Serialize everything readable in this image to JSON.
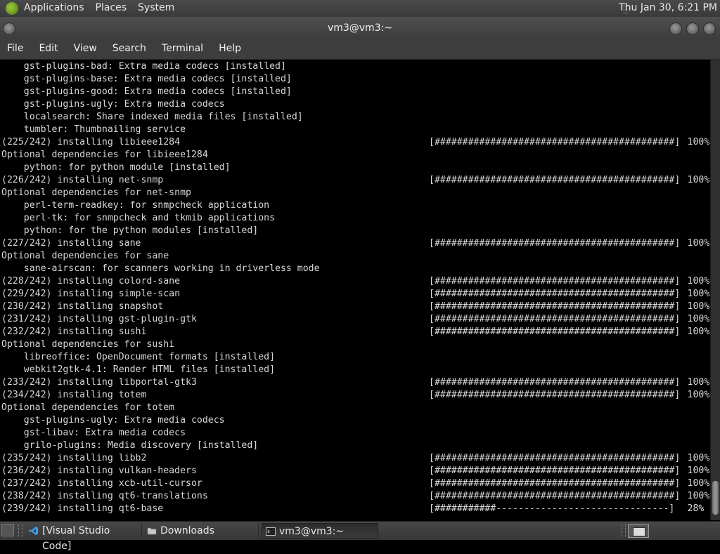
{
  "top_panel": {
    "menus": [
      "Applications",
      "Places",
      "System"
    ],
    "clock": "Thu Jan 30,  6:21 PM"
  },
  "window": {
    "title": "vm3@vm3:~",
    "menu": [
      "File",
      "Edit",
      "View",
      "Search",
      "Terminal",
      "Help"
    ]
  },
  "terminal": {
    "lines": [
      {
        "text": "    gst-plugins-bad: Extra media codecs [installed]",
        "bar": "",
        "pct": ""
      },
      {
        "text": "    gst-plugins-base: Extra media codecs [installed]",
        "bar": "",
        "pct": ""
      },
      {
        "text": "    gst-plugins-good: Extra media codecs [installed]",
        "bar": "",
        "pct": ""
      },
      {
        "text": "    gst-plugins-ugly: Extra media codecs",
        "bar": "",
        "pct": ""
      },
      {
        "text": "    localsearch: Share indexed media files [installed]",
        "bar": "",
        "pct": ""
      },
      {
        "text": "    tumbler: Thumbnailing service",
        "bar": "",
        "pct": ""
      },
      {
        "text": "(225/242) installing libieee1284",
        "bar": "[###########################################]",
        "pct": "100%"
      },
      {
        "text": "Optional dependencies for libieee1284",
        "bar": "",
        "pct": ""
      },
      {
        "text": "    python: for python module [installed]",
        "bar": "",
        "pct": ""
      },
      {
        "text": "(226/242) installing net-snmp",
        "bar": "[###########################################]",
        "pct": "100%"
      },
      {
        "text": "Optional dependencies for net-snmp",
        "bar": "",
        "pct": ""
      },
      {
        "text": "    perl-term-readkey: for snmpcheck application",
        "bar": "",
        "pct": ""
      },
      {
        "text": "    perl-tk: for snmpcheck and tkmib applications",
        "bar": "",
        "pct": ""
      },
      {
        "text": "    python: for the python modules [installed]",
        "bar": "",
        "pct": ""
      },
      {
        "text": "(227/242) installing sane",
        "bar": "[###########################################]",
        "pct": "100%"
      },
      {
        "text": "Optional dependencies for sane",
        "bar": "",
        "pct": ""
      },
      {
        "text": "    sane-airscan: for scanners working in driverless mode",
        "bar": "",
        "pct": ""
      },
      {
        "text": "(228/242) installing colord-sane",
        "bar": "[###########################################]",
        "pct": "100%"
      },
      {
        "text": "(229/242) installing simple-scan",
        "bar": "[###########################################]",
        "pct": "100%"
      },
      {
        "text": "(230/242) installing snapshot",
        "bar": "[###########################################]",
        "pct": "100%"
      },
      {
        "text": "(231/242) installing gst-plugin-gtk",
        "bar": "[###########################################]",
        "pct": "100%"
      },
      {
        "text": "(232/242) installing sushi",
        "bar": "[###########################################]",
        "pct": "100%"
      },
      {
        "text": "Optional dependencies for sushi",
        "bar": "",
        "pct": ""
      },
      {
        "text": "    libreoffice: OpenDocument formats [installed]",
        "bar": "",
        "pct": ""
      },
      {
        "text": "    webkit2gtk-4.1: Render HTML files [installed]",
        "bar": "",
        "pct": ""
      },
      {
        "text": "(233/242) installing libportal-gtk3",
        "bar": "[###########################################]",
        "pct": "100%"
      },
      {
        "text": "(234/242) installing totem",
        "bar": "[###########################################]",
        "pct": "100%"
      },
      {
        "text": "Optional dependencies for totem",
        "bar": "",
        "pct": ""
      },
      {
        "text": "    gst-plugins-ugly: Extra media codecs",
        "bar": "",
        "pct": ""
      },
      {
        "text": "    gst-libav: Extra media codecs",
        "bar": "",
        "pct": ""
      },
      {
        "text": "    grilo-plugins: Media discovery [installed]",
        "bar": "",
        "pct": ""
      },
      {
        "text": "(235/242) installing libb2",
        "bar": "[###########################################]",
        "pct": "100%"
      },
      {
        "text": "(236/242) installing vulkan-headers",
        "bar": "[###########################################]",
        "pct": "100%"
      },
      {
        "text": "(237/242) installing xcb-util-cursor",
        "bar": "[###########################################]",
        "pct": "100%"
      },
      {
        "text": "(238/242) installing qt6-translations",
        "bar": "[###########################################]",
        "pct": "100%"
      },
      {
        "text": "(239/242) installing qt6-base",
        "bar": "[###########-------------------------------]",
        "pct": "28%"
      }
    ]
  },
  "taskbar": {
    "tasks": [
      {
        "label": "[Visual Studio Code]",
        "icon": "vscode-icon"
      },
      {
        "label": "Downloads",
        "icon": "folder-icon"
      },
      {
        "label": "vm3@vm3:~",
        "icon": "terminal-icon"
      }
    ]
  },
  "colors": {
    "panel": "#3a3a3a",
    "terminal_bg": "#000000",
    "terminal_fg": "#d8d8d8"
  }
}
